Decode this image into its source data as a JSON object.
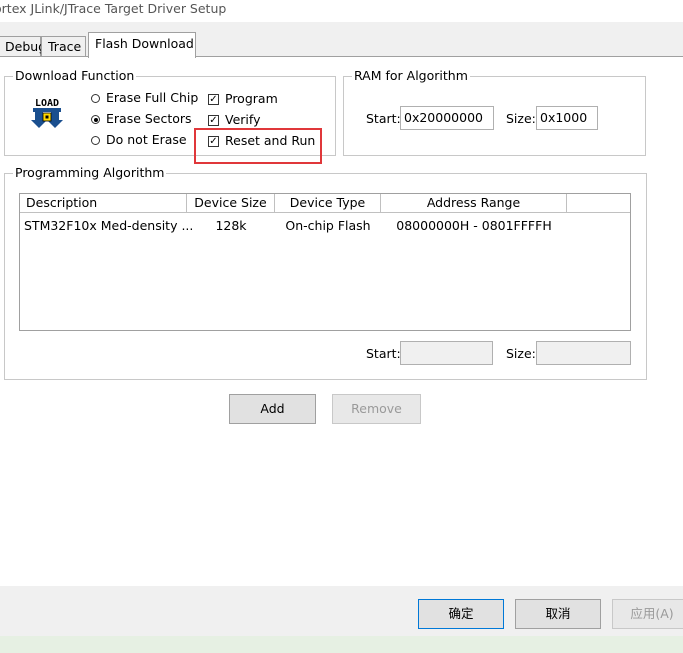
{
  "window": {
    "title": "ortex JLink/JTrace Target Driver Setup"
  },
  "tabs": [
    {
      "label": "Debug"
    },
    {
      "label": "Trace"
    },
    {
      "label": "Flash Download"
    }
  ],
  "download_function": {
    "legend": "Download Function",
    "icon_label": "LOAD",
    "radios": [
      {
        "label": "Erase Full Chip",
        "selected": false
      },
      {
        "label": "Erase Sectors",
        "selected": true
      },
      {
        "label": "Do not Erase",
        "selected": false
      }
    ],
    "checks": [
      {
        "label": "Program",
        "checked": true
      },
      {
        "label": "Verify",
        "checked": true
      },
      {
        "label": "Reset and Run",
        "checked": true
      }
    ],
    "check_mark": "✓"
  },
  "ram": {
    "legend": "RAM for Algorithm",
    "start_label": "Start:",
    "start_value": "0x20000000",
    "size_label": "Size:",
    "size_value": "0x1000"
  },
  "programming_algorithm": {
    "legend": "Programming Algorithm",
    "columns": [
      "Description",
      "Device Size",
      "Device Type",
      "Address Range"
    ],
    "rows": [
      [
        "STM32F10x Med-density ...",
        "128k",
        "On-chip Flash",
        "08000000H - 0801FFFFH"
      ]
    ],
    "start_label": "Start:",
    "start_value": "",
    "size_label": "Size:",
    "size_value": ""
  },
  "buttons": {
    "add": "Add",
    "remove": "Remove"
  },
  "footer": {
    "ok": "确定",
    "cancel": "取消",
    "apply": "应用(A)"
  },
  "colors": {
    "highlight": "#e0373a",
    "panel": "#ffffff",
    "chrome": "#f0f0f0"
  }
}
